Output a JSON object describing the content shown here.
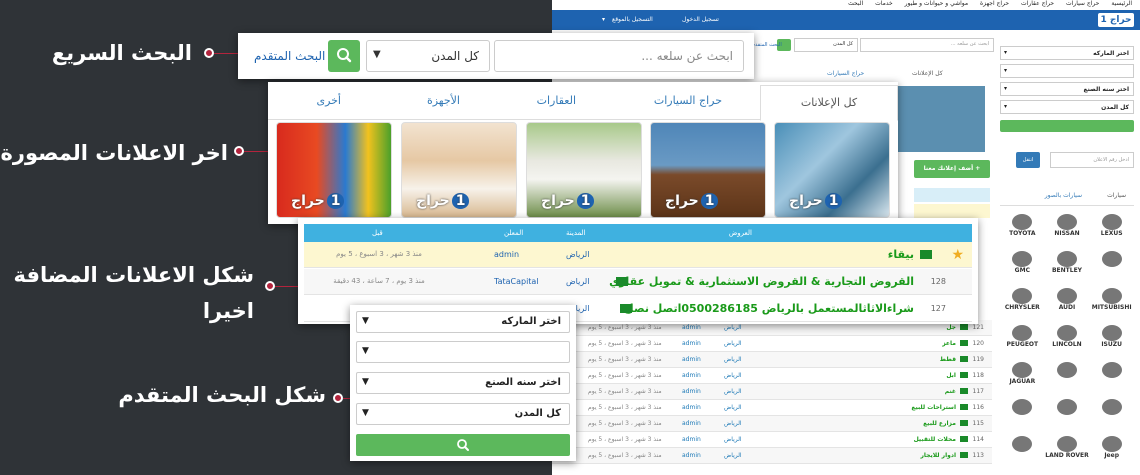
{
  "callouts": {
    "quick_search": "البحث السريع",
    "latest_photo_ads": "اخر الاعلانات المصورة",
    "recent_ads_line1": "شكل الاعلانات المضافة",
    "recent_ads_line2": "اخيرا",
    "advanced_search": "شكل البحث المتقدم"
  },
  "quick_search": {
    "placeholder": "ابحث عن سلعه ...",
    "city_select": "كل المدن",
    "advanced_link": "البحث المتقدم",
    "search_icon": "magnifier-icon"
  },
  "tabs": [
    "كل الإعلانات",
    "حراج السيارات",
    "العقارات",
    "الأجهزة",
    "أخرى"
  ],
  "thumbnails": [
    {
      "subject": "mixed",
      "watermark": "حراج"
    },
    {
      "subject": "horse",
      "watermark": "حراج"
    },
    {
      "subject": "goats",
      "watermark": "حراج"
    },
    {
      "subject": "kittens",
      "watermark": "حراج"
    },
    {
      "subject": "parrots",
      "watermark": "حراج"
    }
  ],
  "ads_table": {
    "headers": {
      "offers": "العروض",
      "city": "المدينة",
      "advertiser": "المعلن",
      "ago": "قبل"
    },
    "rows": [
      {
        "num": "",
        "title": "بيقاء",
        "city": "الرياض",
        "user": "admin",
        "date": "منذ 3 شهر ، 3 اسبوع ، 5 يوم",
        "featured": true
      },
      {
        "num": "128",
        "title": "القروض التجارية & القروض الاستثمارية & تمويل عقاري",
        "city": "الرياض",
        "user": "TataCapital",
        "date": "منذ 3 يوم ، 7 ساعة ، 43 دقيقة",
        "featured": false
      },
      {
        "num": "127",
        "title": "شراءالاثاثالمستعمل بالرياض 0500286185اتصل نصل",
        "city": "الرياض",
        "user": "",
        "date": "",
        "featured": false
      }
    ]
  },
  "advanced_search": {
    "brand": "اختر الماركه",
    "model": "",
    "year": "اختر سنه الصنع",
    "city": "كل المدن",
    "button_icon": "magnifier-icon"
  },
  "site": {
    "top_links": [
      "الرئيسية",
      "حراج سيارات",
      "حراج عقارات",
      "حراج اجهزة",
      "مواشي و حيوانات و طيور",
      "خدمات",
      "البحث"
    ],
    "logo": "حراج 1",
    "login": "تسجيل الدخول",
    "register": "التسجيل بالموقع",
    "search_placeholder": "ابحث عن سلعه ...",
    "city_select": "كل المدن",
    "advanced_link": "البحث المتقدم",
    "sidebar": {
      "brand": "اختر الماركه",
      "year": "اختر سنه الصنع",
      "city": "كل المدن",
      "ad_number_placeholder": "ادخل رقم الاعلان",
      "ad_number_button": "انتقل",
      "tab_cars": "سيارات",
      "tab_cars_photos": "سيارات بالصور"
    },
    "brands": [
      "TOYOTA",
      "NISSAN",
      "LEXUS",
      "GMC",
      "BENTLEY",
      "",
      "CHRYSLER",
      "AUDI",
      "MITSUBISHI",
      "PEUGEOT",
      "LINCOLN",
      "ISUZU",
      "JAGUAR",
      "",
      "",
      "",
      "",
      "",
      "",
      "LAND ROVER",
      "Jeep"
    ],
    "add_ad": "أضف إعلانك معنا",
    "tab_all": "كل الإعلانات",
    "tab_cars": "حراج السيارات",
    "row_date": "منذ 3 شهر ، 3 اسبوع ، 5 يوم",
    "row_user": "admin",
    "row_city": "الرياض",
    "rows": [
      {
        "num": "121",
        "title": "جل"
      },
      {
        "num": "120",
        "title": "ماعز"
      },
      {
        "num": "119",
        "title": "قطط"
      },
      {
        "num": "118",
        "title": "ابل"
      },
      {
        "num": "117",
        "title": "غنم"
      },
      {
        "num": "116",
        "title": "استراحات للبيع"
      },
      {
        "num": "115",
        "title": "مزارع للبيع"
      },
      {
        "num": "114",
        "title": "محلات للتقبيل"
      },
      {
        "num": "113",
        "title": "ادوار للايجار"
      }
    ]
  },
  "colors": {
    "background": "#2f3337",
    "accent_blue": "#1e63b0",
    "green": "#5cb85c",
    "callout_dot": "#b3243d",
    "table_header": "#3fb1e0"
  }
}
